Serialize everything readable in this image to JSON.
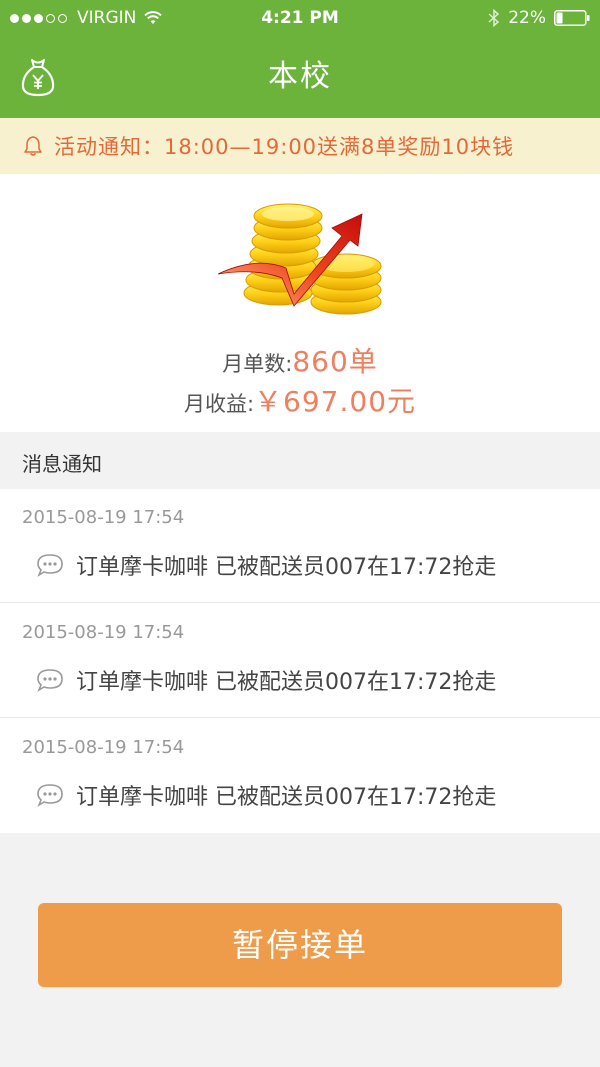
{
  "status_bar": {
    "carrier": "VIRGIN",
    "time": "4:21 PM",
    "battery": "22%",
    "battery_level": 0.22
  },
  "nav": {
    "title": "本校",
    "left_icon": "wallet-yen-icon"
  },
  "notice": {
    "text": "活动通知：18:00—19:00送满8单奖励10块钱"
  },
  "stats": {
    "orders_label": "月单数:",
    "orders_value": "860单",
    "income_label": "月收益:",
    "income_value": "￥697.00元"
  },
  "messages": {
    "header": "消息通知",
    "items": [
      {
        "time": "2015-08-19 17:54",
        "text": "订单摩卡咖啡 已被配送员007在17:72抢走"
      },
      {
        "time": "2015-08-19 17:54",
        "text": "订单摩卡咖啡 已被配送员007在17:72抢走"
      },
      {
        "time": "2015-08-19 17:54",
        "text": "订单摩卡咖啡 已被配送员007在17:72抢走"
      }
    ]
  },
  "actions": {
    "pause_label": "暂停接单"
  },
  "colors": {
    "brand_green": "#6bb33a",
    "notice_bg": "#f7f1cf",
    "notice_text": "#e26a3a",
    "accent_value": "#ee8060",
    "button": "#ee9c4a"
  }
}
